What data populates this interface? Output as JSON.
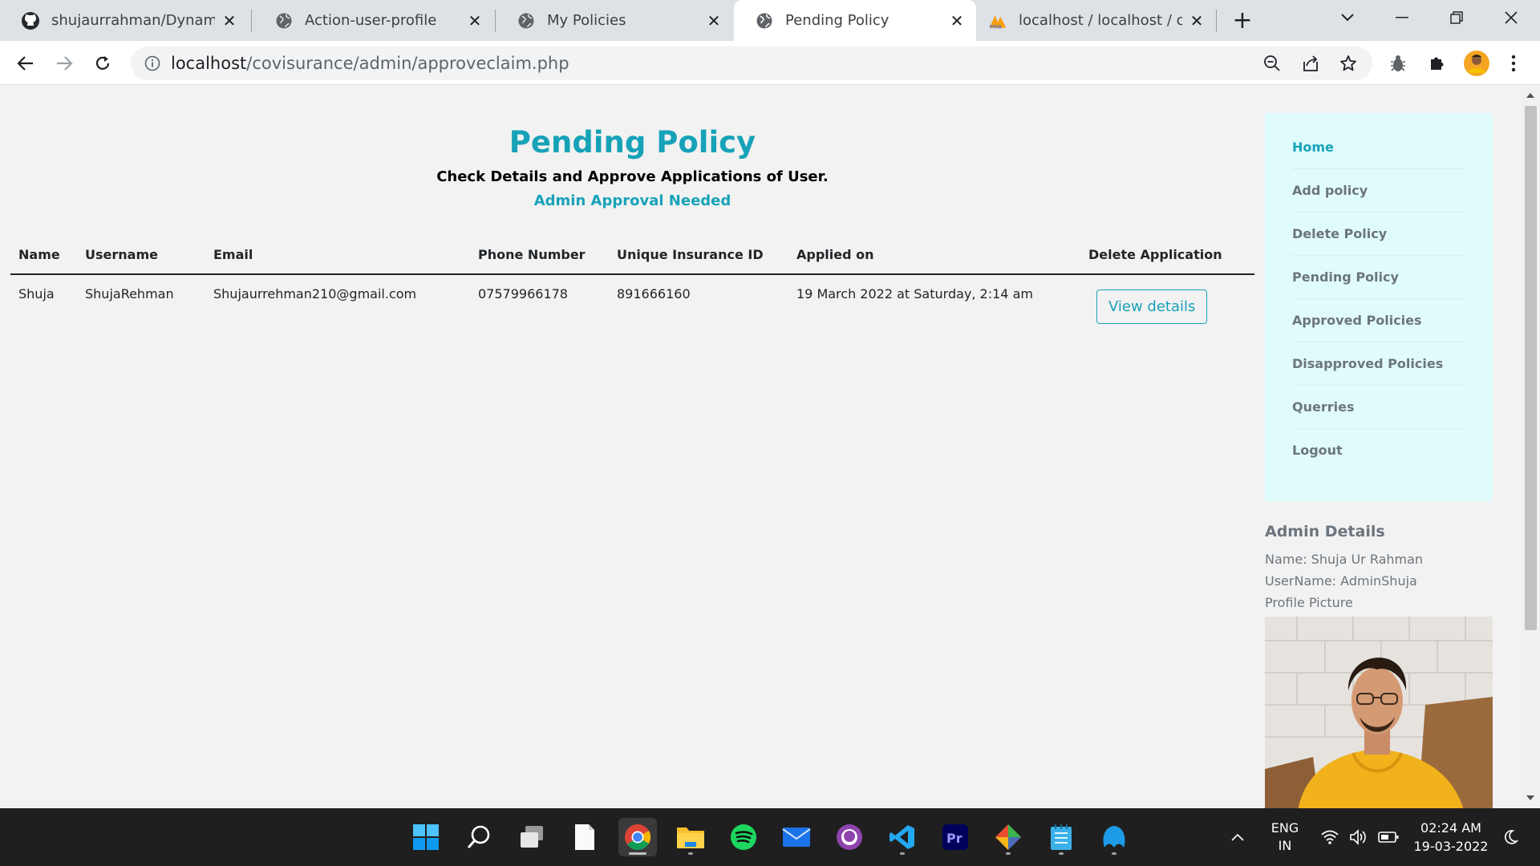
{
  "browser": {
    "tabs": [
      {
        "title": "shujaurrahman/Dynamic-I",
        "icon": "github-icon"
      },
      {
        "title": "Action-user-profile",
        "icon": "globe-icon"
      },
      {
        "title": "My Policies",
        "icon": "globe-icon"
      },
      {
        "title": "Pending Policy",
        "icon": "globe-icon",
        "active": true
      },
      {
        "title": "localhost / localhost / cov",
        "icon": "phpmyadmin-icon"
      }
    ],
    "url_host": "localhost",
    "url_path": "/covisurance/admin/approveclaim.php"
  },
  "page": {
    "title": "Pending Policy",
    "subtitle": "Check Details and Approve Applications of User.",
    "notice": "Admin Approval Needed"
  },
  "table": {
    "headers": [
      "Name",
      "Username",
      "Email",
      "Phone Number",
      "Unique Insurance ID",
      "Applied on",
      "Delete Application"
    ],
    "rows": [
      {
        "name": "Shuja",
        "username": "ShujaRehman",
        "email": "Shujaurrehman210@gmail.com",
        "phone": "07579966178",
        "insurance_id": "891666160",
        "applied_on": "19 March 2022 at Saturday, 2:14 am",
        "action": "View details"
      }
    ]
  },
  "sidebar": {
    "items": [
      "Home",
      "Add policy",
      "Delete Policy",
      "Pending Policy",
      "Approved Policies",
      "Disapproved Policies",
      "Querries",
      "Logout"
    ]
  },
  "admin": {
    "title": "Admin Details",
    "name_line": "Name: Shuja Ur Rahman",
    "username_line": "UserName: AdminShuja",
    "picture_label": "Profile Picture"
  },
  "taskbar": {
    "lang_top": "ENG",
    "lang_bottom": "IN",
    "time": "02:24 AM",
    "date": "19-03-2022"
  },
  "colors": {
    "accent": "#17a2b8",
    "sidebar_bg": "#e0fbfc",
    "page_bg": "#f2f2f2",
    "taskbar_bg": "#1f1f1f"
  }
}
